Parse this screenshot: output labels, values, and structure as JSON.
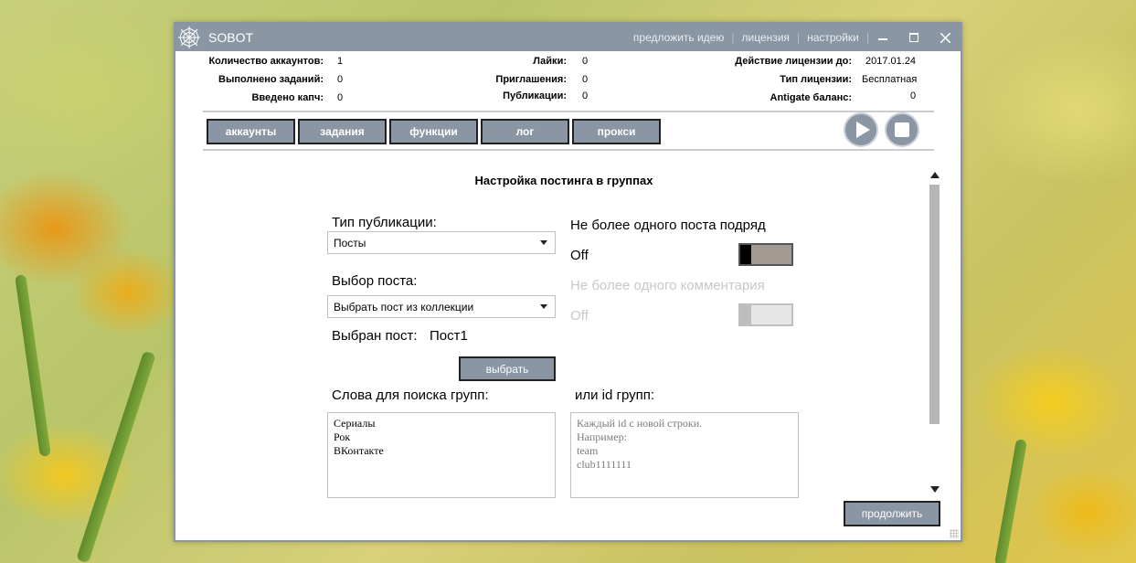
{
  "window": {
    "title": "SOBOT",
    "links": [
      "предложить идею",
      "лицензия",
      "настройки"
    ]
  },
  "stats": {
    "accounts_label": "Количество аккаунтов:",
    "accounts_value": "1",
    "tasks_label": "Выполнено заданий:",
    "tasks_value": "0",
    "captcha_label": "Введено капч:",
    "captcha_value": "0",
    "likes_label": "Лайки:",
    "likes_value": "0",
    "invites_label": "Приглашения:",
    "invites_value": "0",
    "posts_label": "Публикации:",
    "posts_value": "0",
    "license_until_label": "Действие лицензии до:",
    "license_until_value": "2017.01.24",
    "license_type_label": "Тип лицензии:",
    "license_type_value": "Бесплатная",
    "antigate_label": "Antigate баланс:",
    "antigate_value": "0"
  },
  "nav": {
    "accounts": "аккаунты",
    "tasks": "задания",
    "functions": "функции",
    "log": "лог",
    "proxy": "прокси"
  },
  "content": {
    "title": "Настройка постинга в группах",
    "publication_type_label": "Тип публикации:",
    "publication_type_value": "Посты",
    "post_choice_label": "Выбор поста:",
    "post_choice_value": "Выбрать пост из коллекции",
    "selected_post_label": "Выбран пост:",
    "selected_post_value": "Пост1",
    "choose_button": "выбрать",
    "one_post_label": "Не более одного поста подряд",
    "one_post_state": "Off",
    "one_comment_label": "Не более одного комментария",
    "one_comment_state": "Off",
    "search_words_label": "Слова для поиска групп:",
    "search_words": [
      "Сериалы",
      "Рок",
      "ВКонтакте"
    ],
    "group_ids_label": "или id групп:",
    "group_ids_placeholder": [
      "Каждый id с новой строки.",
      "Например:",
      "team",
      "club1111111"
    ],
    "continue_button": "продолжить"
  },
  "colors": {
    "titlebar": "#8a96a3",
    "button": "#8a96a3"
  }
}
